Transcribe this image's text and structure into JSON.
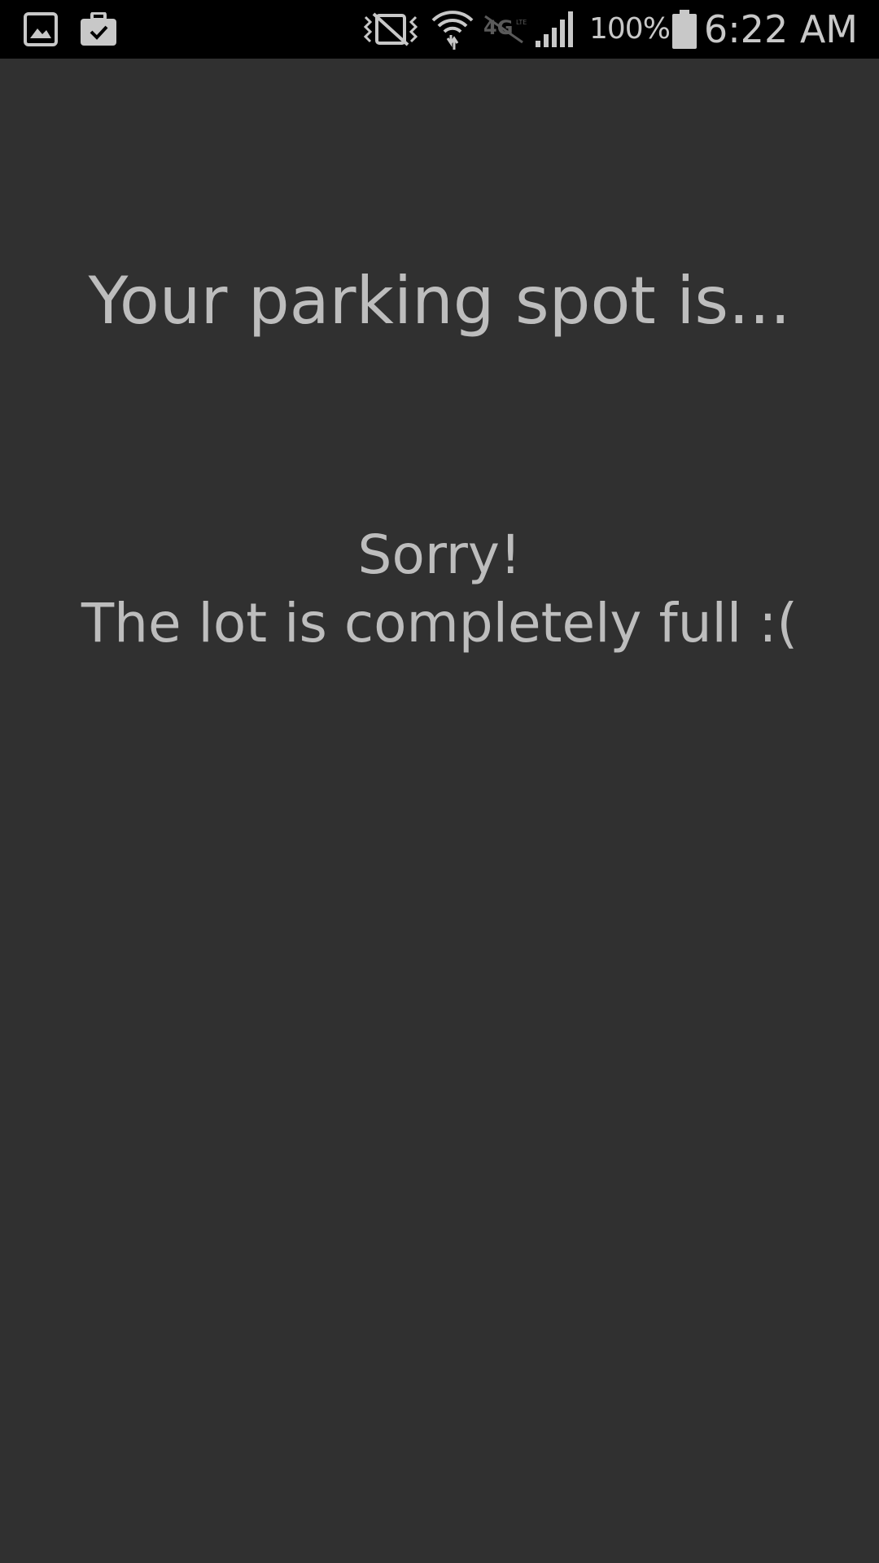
{
  "status_bar": {
    "left_icons": [
      "gallery-notification-icon",
      "briefcase-check-notification-icon"
    ],
    "right_icons": [
      "vibrate-mute-icon",
      "wifi-icon",
      "4g-lte-off-icon",
      "cell-signal-icon",
      "battery-icon"
    ],
    "battery_percent": "100%",
    "time": "6:22 AM"
  },
  "main": {
    "heading": "Your parking spot is...",
    "message_line1": "Sorry!",
    "message_line2": "The lot is completely full :("
  },
  "colors": {
    "background": "#303030",
    "status_bar": "#000000",
    "text": "#bdbdbd"
  }
}
